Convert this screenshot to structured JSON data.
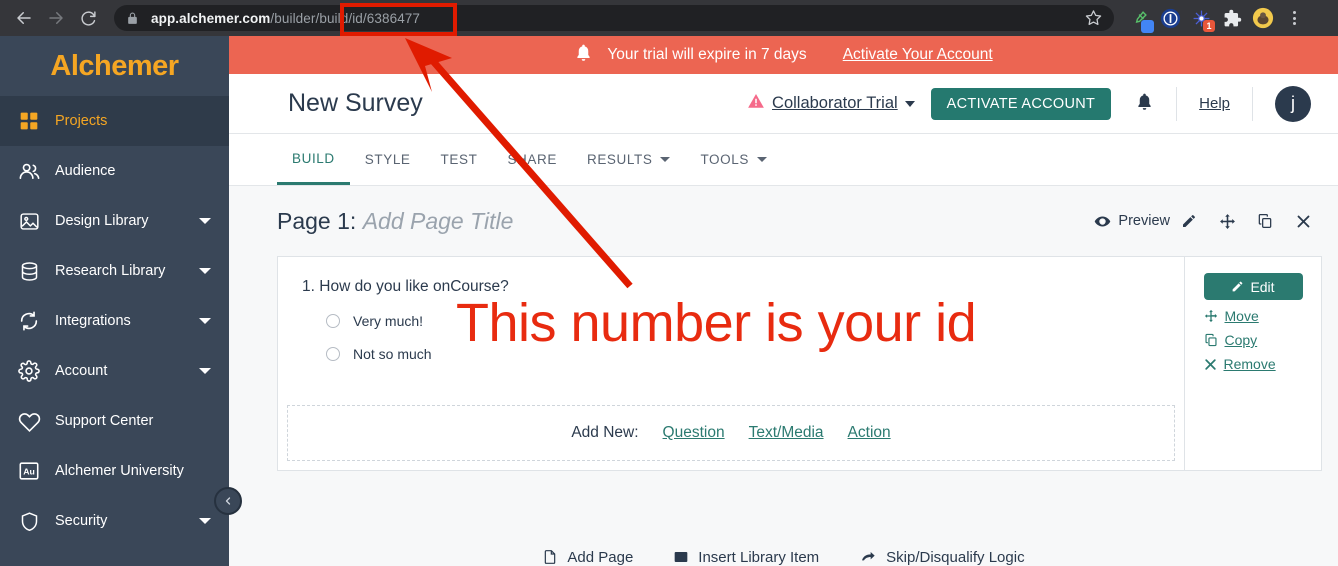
{
  "browser": {
    "back_icon": "back-arrow-icon",
    "forward_icon": "forward-arrow-icon",
    "reload_icon": "reload-icon",
    "lock_icon": "lock-icon",
    "url_bold": "app.alchemer.com",
    "url_rest": "/builder/build/id/6386477",
    "url_full": "app.alchemer.com/builder/build/id/6386477",
    "star_icon": "bookmark-star-icon",
    "extensions": [
      {
        "name": "eyedropper-extension-icon",
        "badge": ""
      },
      {
        "name": "onepassword-extension-icon",
        "badge": ""
      },
      {
        "name": "grammarly-extension-icon",
        "badge": "1"
      },
      {
        "name": "puzzle-extensions-icon",
        "badge": ""
      },
      {
        "name": "profile-avatar-icon",
        "badge": ""
      }
    ],
    "menu_icon": "kebab-menu-icon"
  },
  "sidebar": {
    "logo": "Alchemer",
    "collapse_icon": "chevron-left-icon",
    "items": [
      {
        "label": "Projects",
        "icon": "grid-icon",
        "caret": false,
        "active": true
      },
      {
        "label": "Audience",
        "icon": "people-icon",
        "caret": false,
        "active": false
      },
      {
        "label": "Design Library",
        "icon": "image-icon",
        "caret": true,
        "active": false
      },
      {
        "label": "Research Library",
        "icon": "database-icon",
        "caret": true,
        "active": false
      },
      {
        "label": "Integrations",
        "icon": "sync-icon",
        "caret": true,
        "active": false
      },
      {
        "label": "Account",
        "icon": "gear-icon",
        "caret": true,
        "active": false
      },
      {
        "label": "Support Center",
        "icon": "heart-icon",
        "caret": false,
        "active": false
      },
      {
        "label": "Alchemer University",
        "icon": "au-badge-icon",
        "caret": false,
        "active": false
      },
      {
        "label": "Security",
        "icon": "shield-icon",
        "caret": true,
        "active": false
      }
    ]
  },
  "banner": {
    "bell_icon": "bell-icon",
    "message": "Your trial will expire in 7 days",
    "link": "Activate Your Account",
    "color": "#ec6552"
  },
  "header": {
    "survey_title": "New Survey",
    "warning_icon": "warning-triangle-icon",
    "account_link": "Collaborator Trial",
    "activate_button": "ACTIVATE ACCOUNT",
    "activate_color": "#25796f",
    "bell_icon": "bell-icon",
    "help_label": "Help",
    "avatar_initial": "j"
  },
  "tabs": [
    {
      "label": "BUILD",
      "caret": false,
      "active": true
    },
    {
      "label": "STYLE",
      "caret": false,
      "active": false
    },
    {
      "label": "TEST",
      "caret": false,
      "active": false
    },
    {
      "label": "SHARE",
      "caret": false,
      "active": false
    },
    {
      "label": "RESULTS",
      "caret": true,
      "active": false
    },
    {
      "label": "TOOLS",
      "caret": true,
      "active": false
    }
  ],
  "page": {
    "label": "Page 1:",
    "title_placeholder": "Add Page Title",
    "preview_label": "Preview",
    "preview_icon": "eye-icon",
    "actions": [
      {
        "icon": "pencil-icon"
      },
      {
        "icon": "move-arrows-icon"
      },
      {
        "icon": "copy-icon"
      },
      {
        "icon": "close-x-icon"
      }
    ]
  },
  "question": {
    "number": "1.",
    "text": "How do you like onCourse?",
    "options": [
      {
        "label": "Very much!"
      },
      {
        "label": "Not so much"
      }
    ],
    "side_actions": [
      {
        "label": "Edit",
        "icon": "pencil-icon",
        "primary": true
      },
      {
        "label": "Move",
        "icon": "move-arrows-icon",
        "primary": false
      },
      {
        "label": "Copy",
        "icon": "copy-icon",
        "primary": false
      },
      {
        "label": "Remove",
        "icon": "close-x-icon",
        "primary": false
      }
    ]
  },
  "add_new": {
    "label": "Add New:",
    "links": [
      {
        "label": "Question"
      },
      {
        "label": "Text/Media"
      },
      {
        "label": "Action"
      }
    ]
  },
  "bottom_bar": [
    {
      "label": "Add Page",
      "icon": "page-plus-icon"
    },
    {
      "label": "Insert Library Item",
      "icon": "library-icon"
    },
    {
      "label": "Skip/Disqualify Logic",
      "icon": "skip-arrow-icon"
    }
  ],
  "annotation": {
    "text": "This number is your id",
    "color": "#e82b10",
    "highlight_target": "/id/6386477",
    "arrow_icon": "red-arrow-icon"
  }
}
